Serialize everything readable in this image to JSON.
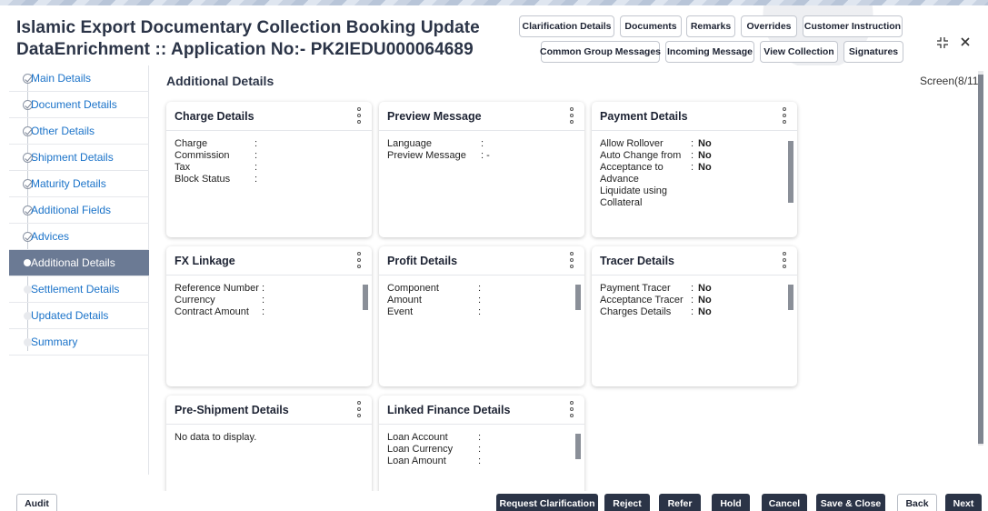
{
  "header": {
    "title_line1": "Islamic Export Documentary Collection Booking Update",
    "title_line2": "DataEnrichment :: Application No:- PK2IEDU000064689",
    "buttons_row1": [
      "Clarification Details",
      "Documents",
      "Remarks",
      "Overrides",
      "Customer Instruction"
    ],
    "buttons_row2": [
      "Common Group Messages",
      "Incoming Message",
      "View Collection",
      "Signatures"
    ],
    "expand_icon": "expand-icon",
    "close_icon": "close-icon"
  },
  "sidebar": {
    "items": [
      {
        "label": "Main Details",
        "state": "done"
      },
      {
        "label": "Document Details",
        "state": "done"
      },
      {
        "label": "Other Details",
        "state": "done"
      },
      {
        "label": "Shipment Details",
        "state": "done"
      },
      {
        "label": "Maturity Details",
        "state": "done"
      },
      {
        "label": "Additional Fields",
        "state": "done"
      },
      {
        "label": "Advices",
        "state": "done"
      },
      {
        "label": "Additional Details",
        "state": "current"
      },
      {
        "label": "Settlement Details",
        "state": "pending"
      },
      {
        "label": "Updated Details",
        "state": "pending"
      },
      {
        "label": "Summary",
        "state": "pending"
      }
    ]
  },
  "main": {
    "title": "Additional Details",
    "screen_indicator": "Screen(8/11)"
  },
  "cards": {
    "charge": {
      "title": "Charge Details",
      "rows": [
        {
          "k": "Charge",
          "sep": ":",
          "v": ""
        },
        {
          "k": "Commission",
          "sep": ":",
          "v": ""
        },
        {
          "k": "Tax",
          "sep": ":",
          "v": ""
        },
        {
          "k": "Block Status",
          "sep": ":",
          "v": ""
        }
      ]
    },
    "preview": {
      "title": "Preview Message",
      "rows": [
        {
          "k": "Language",
          "sep": ":",
          "v": ""
        },
        {
          "k": "Preview Message",
          "sep": ": -",
          "v": ""
        }
      ]
    },
    "payment": {
      "title": "Payment Details",
      "rows": [
        {
          "k": "Allow Rollover",
          "sep": ":",
          "v": "No"
        },
        {
          "k": "Auto Change from",
          "sep": ":",
          "v": "No"
        },
        {
          "k": "Acceptance to",
          "sep": ":",
          "v": "No"
        },
        {
          "k": "Advance",
          "sep": "",
          "v": ""
        },
        {
          "k": "Liquidate using",
          "sep": "",
          "v": ""
        },
        {
          "k": "Collateral",
          "sep": "",
          "v": ""
        }
      ]
    },
    "fx": {
      "title": "FX Linkage",
      "rows": [
        {
          "k": "Reference Number",
          "sep": ":",
          "v": ""
        },
        {
          "k": "Currency",
          "sep": ":",
          "v": ""
        },
        {
          "k": "Contract Amount",
          "sep": ":",
          "v": ""
        }
      ]
    },
    "profit": {
      "title": "Profit Details",
      "rows": [
        {
          "k": "Component",
          "sep": ":",
          "v": ""
        },
        {
          "k": "Amount",
          "sep": ":",
          "v": ""
        },
        {
          "k": "Event",
          "sep": ":",
          "v": ""
        }
      ]
    },
    "tracer": {
      "title": "Tracer Details",
      "rows": [
        {
          "k": "Payment Tracer",
          "sep": ":",
          "v": "No"
        },
        {
          "k": "Acceptance Tracer",
          "sep": ":",
          "v": "No"
        },
        {
          "k": "Charges Details",
          "sep": ":",
          "v": "No"
        }
      ]
    },
    "preshipment": {
      "title": "Pre-Shipment Details",
      "empty_text": "No data to display."
    },
    "linked": {
      "title": "Linked Finance Details",
      "rows": [
        {
          "k": "Loan Account",
          "sep": ":",
          "v": ""
        },
        {
          "k": "Loan Currency",
          "sep": ":",
          "v": ""
        },
        {
          "k": "Loan Amount",
          "sep": ":",
          "v": ""
        }
      ]
    }
  },
  "footer": {
    "audit": "Audit",
    "request_clarification": "Request Clarification",
    "reject": "Reject",
    "refer": "Refer",
    "hold": "Hold",
    "cancel": "Cancel",
    "save_close": "Save & Close",
    "back": "Back",
    "next": "Next"
  },
  "colors": {
    "primary_dark": "#2b3447",
    "link_blue": "#1b73c9",
    "nav_active": "#6b7a94"
  }
}
